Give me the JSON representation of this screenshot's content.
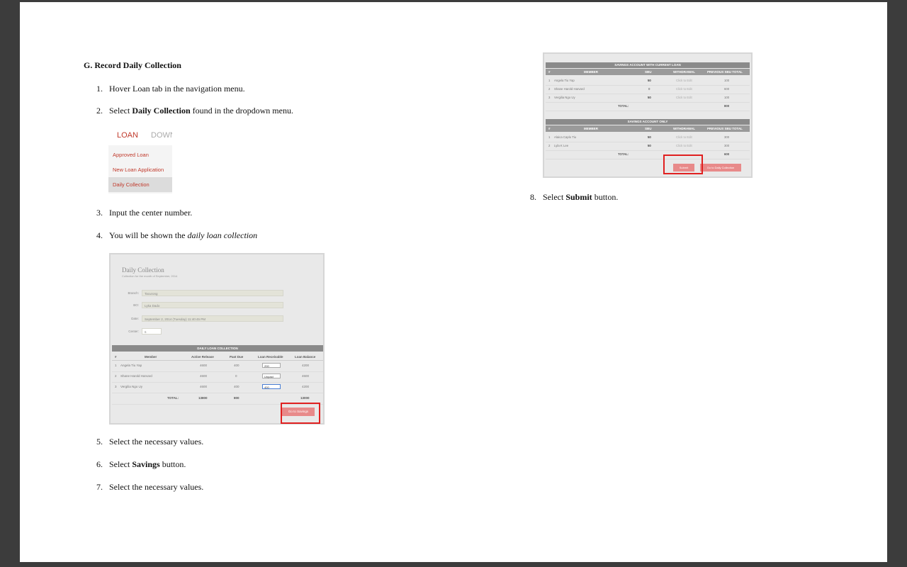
{
  "heading": "G. Record Daily Collection",
  "steps": [
    {
      "num": "1.",
      "text": "Hover Loan tab in the navigation menu."
    },
    {
      "num": "2.",
      "pre": "Select ",
      "bold": "Daily Collection",
      "post": " found in the dropdown menu."
    },
    {
      "num": "3.",
      "text": "Input the center number."
    },
    {
      "num": "4.",
      "pre": "You will be shown the ",
      "italic": "daily loan collection"
    },
    {
      "num": "5.",
      "text": "Select the necessary values."
    },
    {
      "num": "6.",
      "pre": "Select ",
      "bold": "Savings",
      "post": " button."
    },
    {
      "num": "7.",
      "text": "Select the necessary values."
    },
    {
      "num": "8.",
      "pre": "Select ",
      "bold": "Submit",
      "post": " button."
    }
  ],
  "menu_shot": {
    "tab_loan": "LOAN",
    "tab_down": "DOWN",
    "items": [
      "Approved Loan",
      "New Loan Application",
      "Daily Collection"
    ]
  },
  "dc_shot": {
    "title": "Daily Collection",
    "subtitle": "Collection for the month of September, 2014",
    "fields": [
      {
        "label": "Branch:",
        "value": "Tacurong"
      },
      {
        "label": "BO:",
        "value": "Lyka Dado"
      },
      {
        "label": "Date:",
        "value": "September 2, 2014 (Tuesday) 11:40:45 PM"
      },
      {
        "label": "Center:",
        "value": "6"
      }
    ],
    "table_title": "DAILY LOAN COLLECTION",
    "columns": [
      "#",
      "Member",
      "Active Release",
      "Past Due",
      "Loan Receivable",
      "Loan Balance"
    ],
    "rows": [
      [
        "1",
        "Angela Tiu Yap",
        "4600",
        "400",
        "200",
        "4200"
      ],
      [
        "2",
        "Shane Harold Harvard",
        "4600",
        "0",
        "Unpaid",
        "4600"
      ],
      [
        "3",
        "Vergilia Ngo Uy",
        "4600",
        "400",
        "400",
        "4200"
      ]
    ],
    "total_label": "TOTAL:",
    "totals": [
      "13800",
      "800",
      "13000"
    ],
    "button": "Go to Savings"
  },
  "sv_shot": {
    "table1_title": "SAVINGS ACCOUNT WITH CURRENT LOAN",
    "table2_title": "SAVINGS ACCOUNT ONLY",
    "columns": [
      "#",
      "MEMBER",
      "SBU",
      "WITHDRAWAL",
      "PREVIOUS SBU TOTAL"
    ],
    "rows1": [
      [
        "1",
        "Angela Tiu Yap",
        "50",
        "Click to Edit",
        "100"
      ],
      [
        "2",
        "Shane Harold Harvard",
        "0",
        "Click to Edit",
        "600"
      ],
      [
        "3",
        "Vergilia Ngo Uy",
        "50",
        "Click to Edit",
        "100"
      ]
    ],
    "total1": "800",
    "rows2": [
      [
        "1",
        "Alaica Caplo Tiu",
        "50",
        "Click to Edit",
        "300"
      ],
      [
        "2",
        "Lyla K Lee",
        "50",
        "Click to Edit",
        "300"
      ]
    ],
    "total2": "600",
    "total_label": "TOTAL:",
    "submit": "Submit",
    "go_daily": "Go to Daily Collection"
  }
}
